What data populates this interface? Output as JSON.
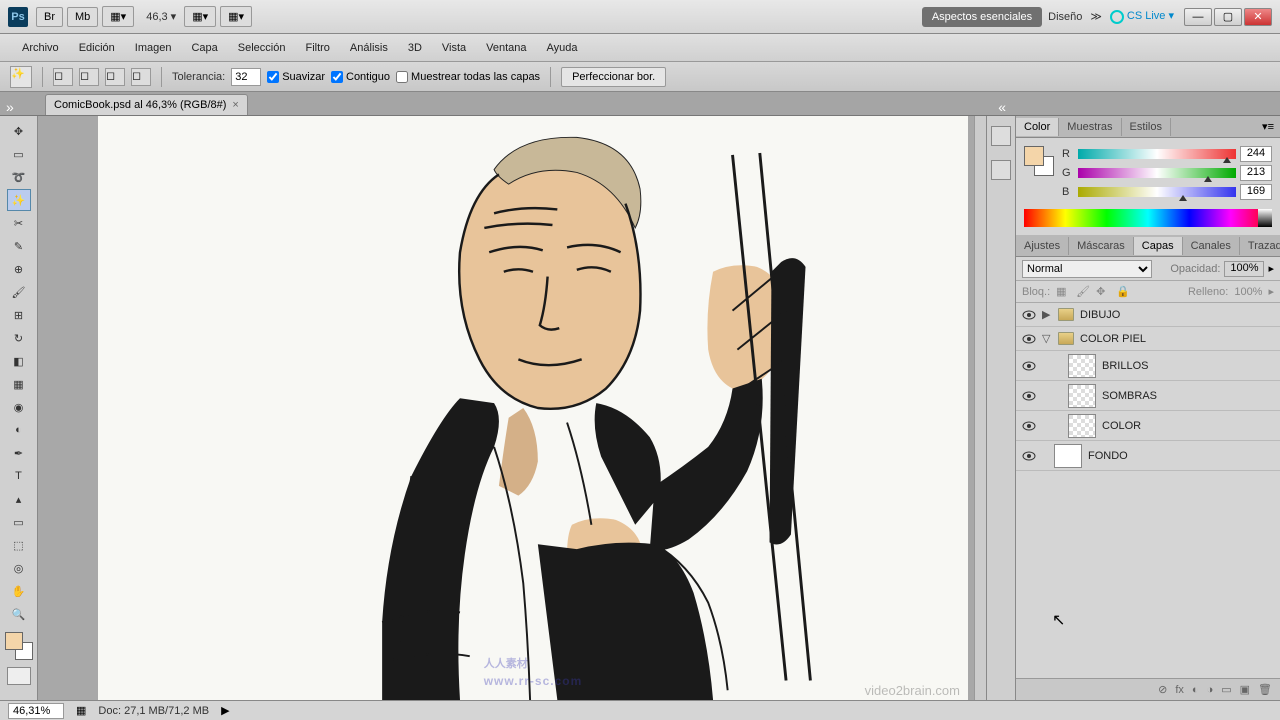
{
  "titlebar": {
    "ps": "Ps",
    "br": "Br",
    "mb": "Mb",
    "zoom": "46,3",
    "workspace_active": "Aspectos esenciales",
    "workspace_design": "Diseño",
    "cslive": "CS Live"
  },
  "menu": {
    "archivo": "Archivo",
    "edicion": "Edición",
    "imagen": "Imagen",
    "capa": "Capa",
    "seleccion": "Selección",
    "filtro": "Filtro",
    "analisis": "Análisis",
    "d3": "3D",
    "vista": "Vista",
    "ventana": "Ventana",
    "ayuda": "Ayuda"
  },
  "options": {
    "tolerance_label": "Tolerancia:",
    "tolerance_value": "32",
    "suavizar": "Suavizar",
    "contiguo": "Contiguo",
    "muestrear": "Muestrear todas las capas",
    "perfeccionar": "Perfeccionar bor."
  },
  "doc_tab": "ComicBook.psd al 46,3% (RGB/8#)",
  "color_panel": {
    "tabs": {
      "color": "Color",
      "muestras": "Muestras",
      "estilos": "Estilos"
    },
    "r": {
      "label": "R",
      "value": "244"
    },
    "g": {
      "label": "G",
      "value": "213"
    },
    "b": {
      "label": "B",
      "value": "169"
    }
  },
  "layers_panel": {
    "tabs": {
      "ajustes": "Ajustes",
      "mascaras": "Máscaras",
      "capas": "Capas",
      "canales": "Canales",
      "trazados": "Trazad"
    },
    "blend_mode": "Normal",
    "opacity_label": "Opacidad:",
    "opacity_value": "100%",
    "lock_label": "Bloq.:",
    "fill_label": "Relleno:",
    "fill_value": "100%",
    "layers": {
      "dibujo": "DIBUJO",
      "color_piel": "COLOR PIEL",
      "brillos": "BRILLOS",
      "sombras": "SOMBRAS",
      "color": "COLOR",
      "fondo": "FONDO"
    }
  },
  "status": {
    "zoom": "46,31%",
    "doc": "Doc: 27,1 MB/71,2 MB"
  },
  "watermark": "人人素材",
  "watermark_sub": "www.rr-sc.com",
  "watermark_right": "video2brain.com"
}
